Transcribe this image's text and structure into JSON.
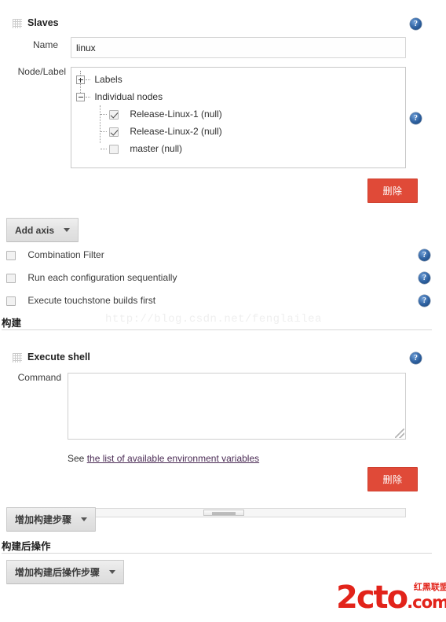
{
  "slaves": {
    "block_title": "Slaves",
    "drag_handle_icon": "drag-grip-icon",
    "help_icon": "help-icon",
    "name_label": "Name",
    "name_value": "linux",
    "name_placeholder": "",
    "node_label": "Node/Label",
    "tree": {
      "labels_node": "Labels",
      "labels_expander": "+",
      "individual_node": "Individual nodes",
      "individual_expander": "-",
      "nodes": [
        {
          "label": "Release-Linux-1 (null)",
          "checked": true
        },
        {
          "label": "Release-Linux-2 (null)",
          "checked": true
        },
        {
          "label": "master (null)",
          "checked": false
        }
      ]
    },
    "delete_label": "删除"
  },
  "axis": {
    "add_axis_label": "Add axis",
    "caret_icon": "chevron-down-icon",
    "options": [
      {
        "label": "Combination Filter",
        "checked": false
      },
      {
        "label": "Run each configuration sequentially",
        "checked": false
      },
      {
        "label": "Execute touchstone builds first",
        "checked": false
      }
    ]
  },
  "build_section": {
    "title": "构建",
    "execute_shell": {
      "block_title": "Execute shell",
      "drag_handle_icon": "drag-grip-icon",
      "help_icon": "help-icon",
      "command_label": "Command",
      "command_value": "",
      "see_prefix": "See ",
      "env_link_label": "the list of available environment variables",
      "delete_label": "删除"
    },
    "add_step_label": "增加构建步骤"
  },
  "post_build_section": {
    "title": "构建后操作",
    "add_step_label": "增加构建后操作步骤"
  },
  "watermarks": {
    "url": "http://blog.csdn.net/fenglailea",
    "logo_main": "2cto",
    "logo_com": ".com",
    "logo_cn": "红黑联盟"
  },
  "colors": {
    "delete_red": "#e04a38",
    "help_blue": "#2c5f9e",
    "link_purple": "#4b2c55",
    "logo_red": "#e2231a"
  }
}
